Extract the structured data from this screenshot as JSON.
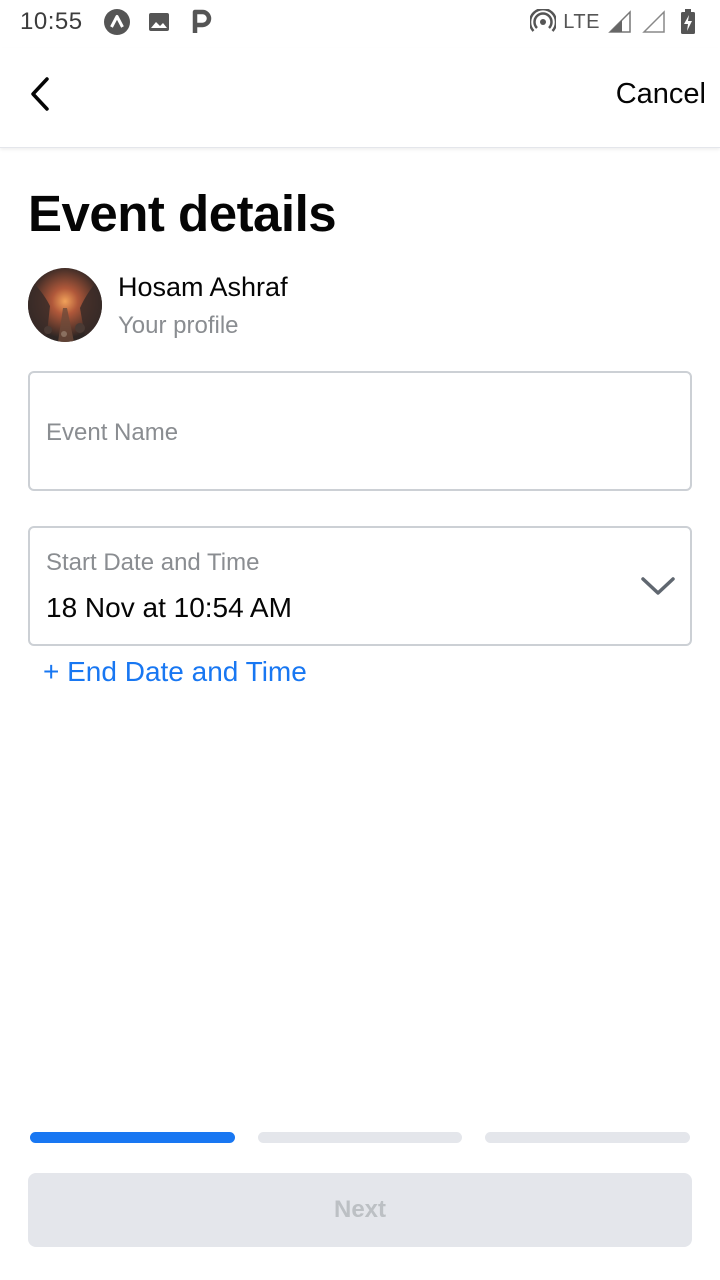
{
  "status_bar": {
    "time": "10:55",
    "left_icons": [
      "app-a-icon",
      "image-icon",
      "parking-p-icon"
    ],
    "network": "LTE",
    "right_icons": [
      "hotspot-icon",
      "signal-icon",
      "signal-empty-icon",
      "battery-charging-icon"
    ]
  },
  "app_bar": {
    "back_icon": "chevron-left-icon",
    "cancel_label": "Cancel"
  },
  "page": {
    "title": "Event details"
  },
  "profile": {
    "name": "Hosam Ashraf",
    "subtitle": "Your profile"
  },
  "form": {
    "event_name_placeholder": "Event Name",
    "start_label": "Start Date and Time",
    "start_value": "18 Nov at 10:54 AM",
    "end_link": "+ End Date and Time"
  },
  "progress": {
    "total_steps": 3,
    "current_step": 1
  },
  "actions": {
    "next_label": "Next"
  },
  "colors": {
    "accent": "#1877f2",
    "muted_text": "#8a8d91",
    "disabled_bg": "#e4e6eb",
    "disabled_text": "#bcc0c4",
    "border": "#ccd0d5"
  }
}
